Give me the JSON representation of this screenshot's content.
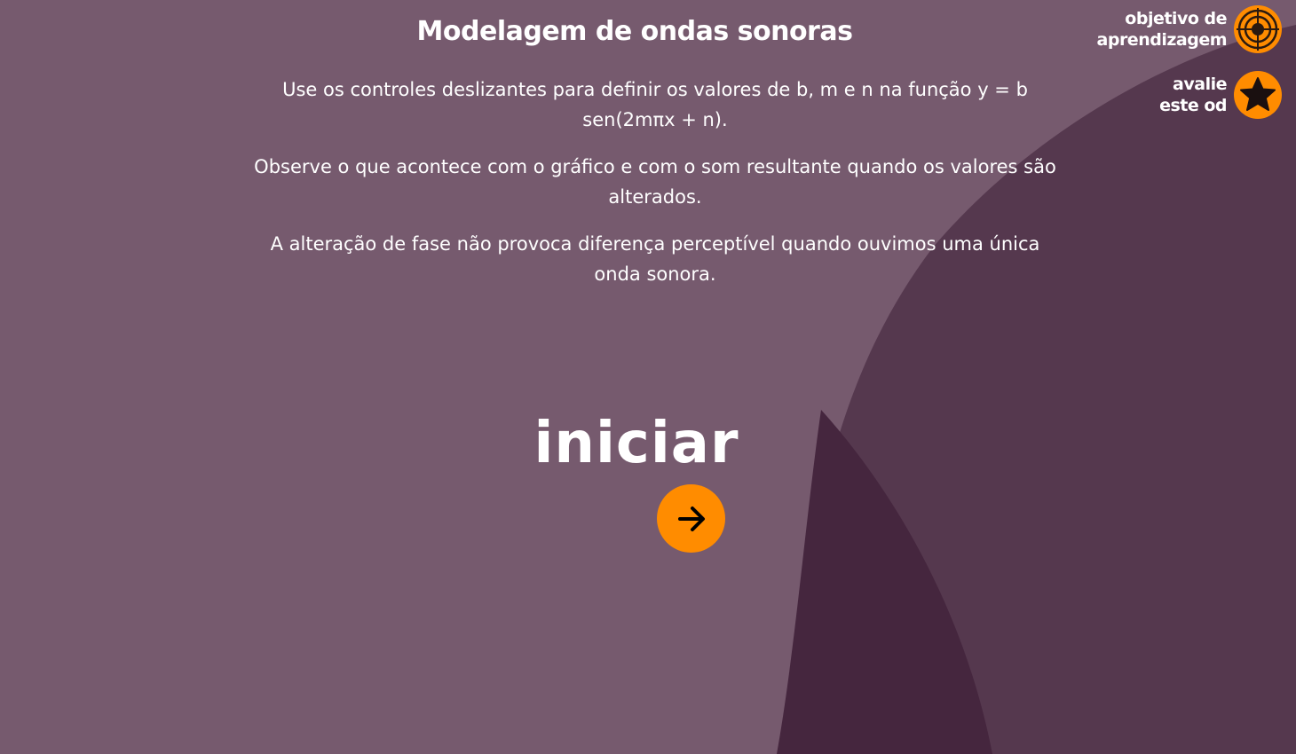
{
  "colors": {
    "background": "#765a6e",
    "shape_mid": "#55384e",
    "shape_dark": "#45263e",
    "accent": "#ff8c00",
    "text": "#ffffff"
  },
  "header": {
    "title": "Modelagem de ondas sonoras"
  },
  "instructions": {
    "paragraph_1": "Use os controles deslizantes para definir os valores de b, m e n na função y = b sen(2mπx + n).",
    "paragraph_2": "Observe o que acontece com o gráfico e com o som resultante quando os valores são alterados.",
    "paragraph_3": "A alteração de fase não provoca diferença perceptível quando ouvimos uma única onda sonora."
  },
  "start": {
    "label": "iniciar",
    "icon": "arrow-right-icon"
  },
  "corner_menu": {
    "objective": {
      "line_1": "objetivo de",
      "line_2": "aprendizagem",
      "icon": "target-icon"
    },
    "rate": {
      "line_1": "avalie",
      "line_2": "este od",
      "icon": "star-icon"
    }
  }
}
